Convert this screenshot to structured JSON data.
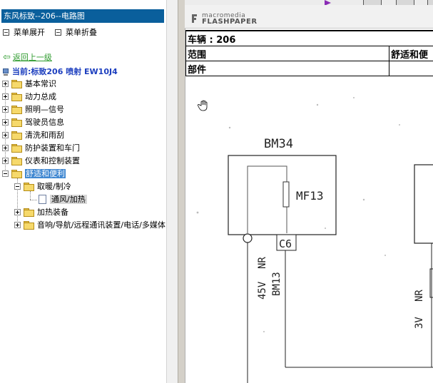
{
  "left_pane": {
    "title": "东风标致--206--电路图",
    "menu_expand": "菜单展开",
    "menu_collapse": "菜单折叠",
    "back_link": "返回上一级",
    "current": "当前:标致206 喷射 EW10J4",
    "tree": [
      {
        "label": "基本常识",
        "expanded": false
      },
      {
        "label": "动力总成",
        "expanded": false
      },
      {
        "label": "照明—信号",
        "expanded": false
      },
      {
        "label": "驾驶员信息",
        "expanded": false
      },
      {
        "label": "清洗和雨刮",
        "expanded": false
      },
      {
        "label": "防护装置和车门",
        "expanded": false
      },
      {
        "label": "仪表和控制装置",
        "expanded": false
      },
      {
        "label": "舒适和便利",
        "expanded": true,
        "highlighted": true,
        "children": [
          {
            "label": "取暖/制冷",
            "expanded": true,
            "children": [
              {
                "label": "通风/加热",
                "selected": true
              }
            ]
          },
          {
            "label": "加热装备",
            "expanded": false
          },
          {
            "label": "音响/导航/远程通讯装置/电话/多媒体",
            "expanded": false
          }
        ]
      }
    ]
  },
  "viewer": {
    "logo_top": "macromedia",
    "logo_bottom": "FLASHPAPER",
    "doc_header": {
      "row1_left": "车辆 : 206",
      "row2_left": "范围",
      "row2_right": "舒适和便",
      "row3_left": "部件"
    },
    "diagram": {
      "box_left_label": "BM34",
      "component_label": "MF13",
      "connector_label": "C6",
      "wire_label_1": "NR",
      "wire_label_2": "45V",
      "wire_label_3": "BM13",
      "wire_label_right_1": "NR",
      "wire_label_right_2": "3V"
    }
  }
}
